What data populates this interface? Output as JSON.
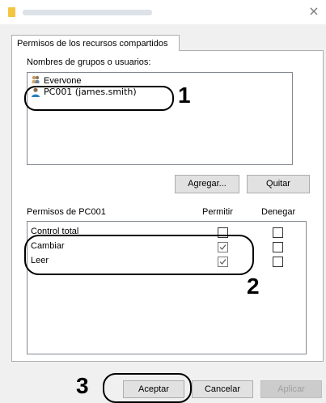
{
  "window": {
    "close_glyph": "×"
  },
  "tabs": [
    "Permisos de los recursos compartidos"
  ],
  "group_list": {
    "label": "Nombres de grupos o usuarios:",
    "items": [
      {
        "name": "Everyone",
        "icon": "group-icon"
      },
      {
        "name": "PC001 (james.smith)",
        "icon": "user-icon",
        "selected": true
      }
    ]
  },
  "buttons": {
    "add": "Agregar...",
    "remove": "Quitar",
    "ok": "Aceptar",
    "cancel": "Cancelar",
    "apply": "Aplicar"
  },
  "permissions": {
    "title": "Permisos de PC001",
    "allow_header": "Permitir",
    "deny_header": "Denegar",
    "rows": [
      {
        "name": "Control total",
        "allow": false,
        "deny": false
      },
      {
        "name": "Cambiar",
        "allow": true,
        "deny": false
      },
      {
        "name": "Leer",
        "allow": true,
        "deny": false
      }
    ]
  },
  "annotations": {
    "step1": "1",
    "step2": "2",
    "step3": "3"
  }
}
